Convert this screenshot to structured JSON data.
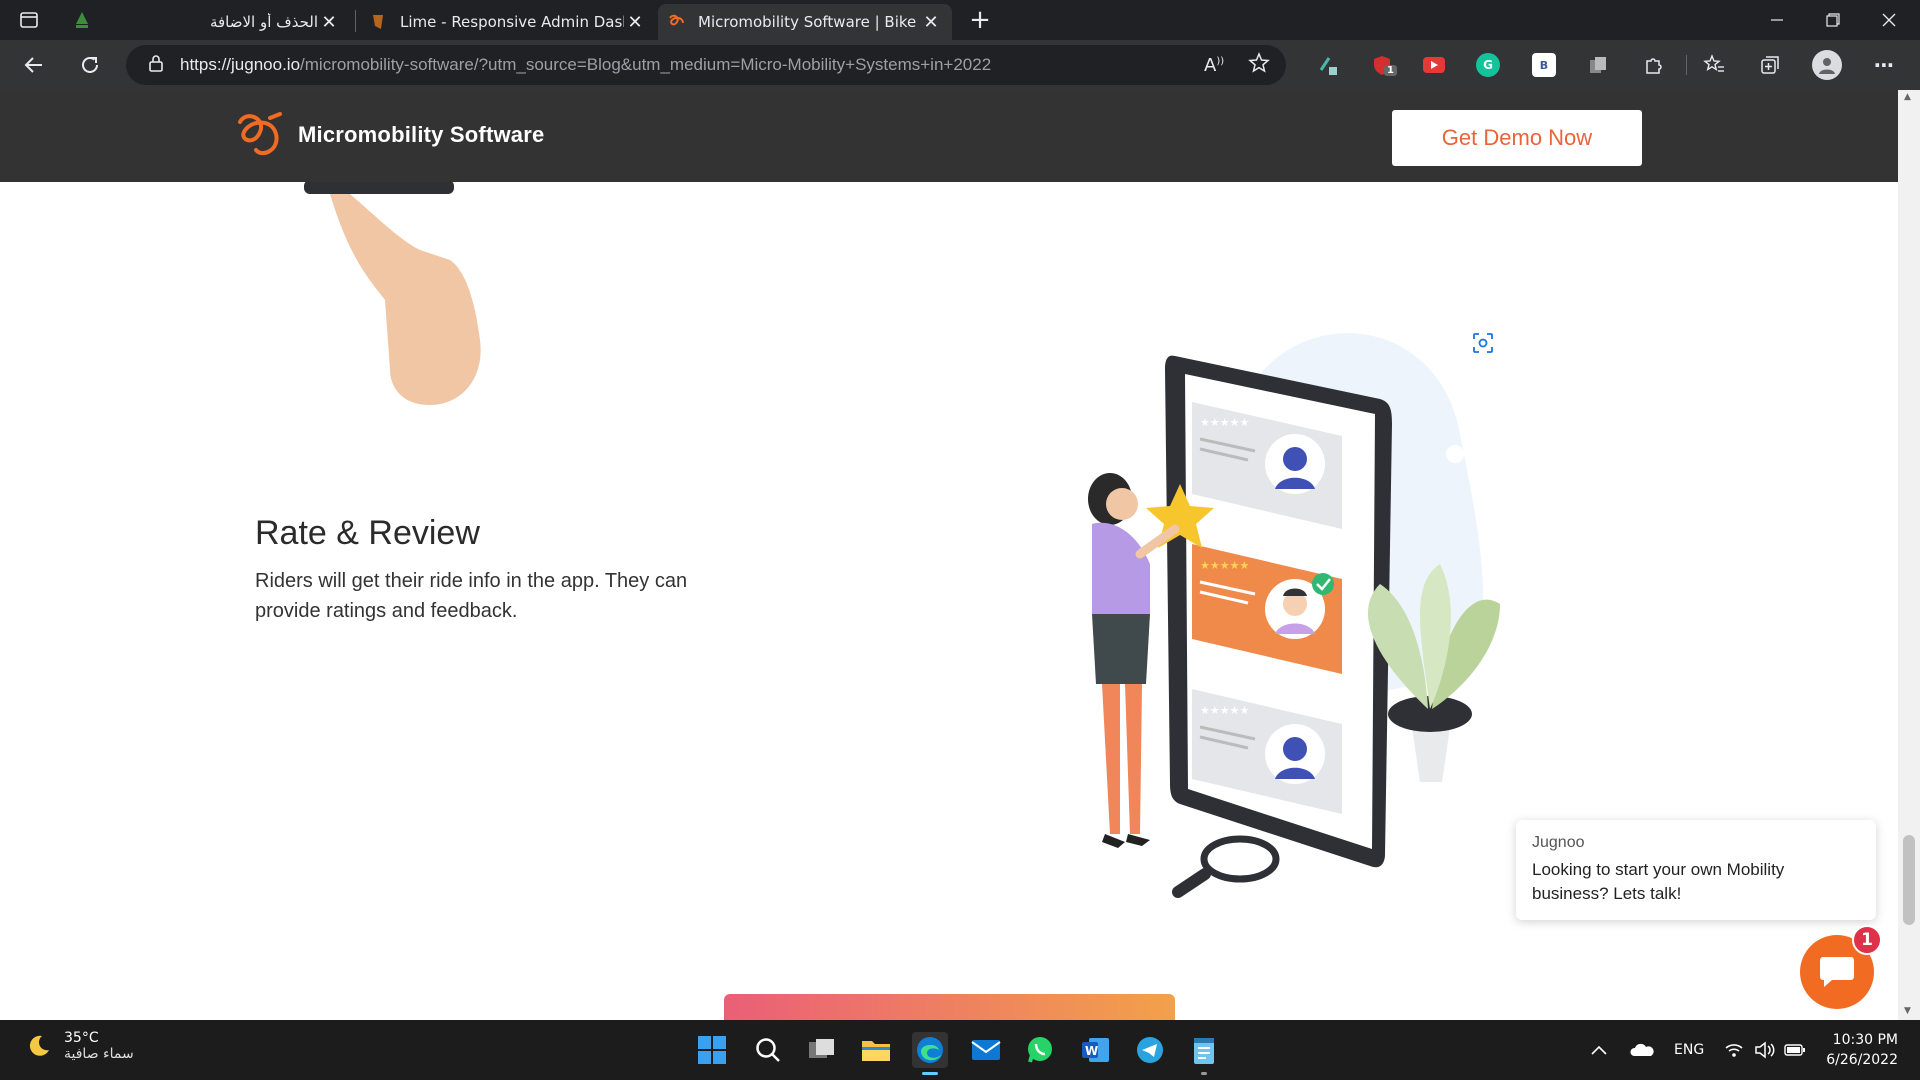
{
  "browser": {
    "tabs": [
      {
        "title": "الحذف أو الاضافة",
        "active": false
      },
      {
        "title": "Lime - Responsive Admin Dashb",
        "active": false
      },
      {
        "title": "Micromobility Software | Bike Sh",
        "active": true
      }
    ],
    "url_host": "https://jugnoo.io",
    "url_path": "/micromobility-software/?utm_source=Blog&utm_medium=Micro-Mobility+Systems+in+2022",
    "read_aloud_label": "A",
    "extension_badge": "1"
  },
  "site": {
    "logo_text": "Micromobility Software",
    "cta_label": "Get Demo Now",
    "brand_color": "#f26b22"
  },
  "feature": {
    "title": "Rate & Review",
    "description": "Riders will get their ride info in the app. They can provide ratings and feedback."
  },
  "chat": {
    "from": "Jugnoo",
    "message": "Looking to start your own Mobility business? Lets talk!",
    "badge_count": "1"
  },
  "taskbar": {
    "temperature": "35°C",
    "condition": "سماء صافية",
    "language": "ENG",
    "time": "10:30 PM",
    "date": "6/26/2022"
  }
}
